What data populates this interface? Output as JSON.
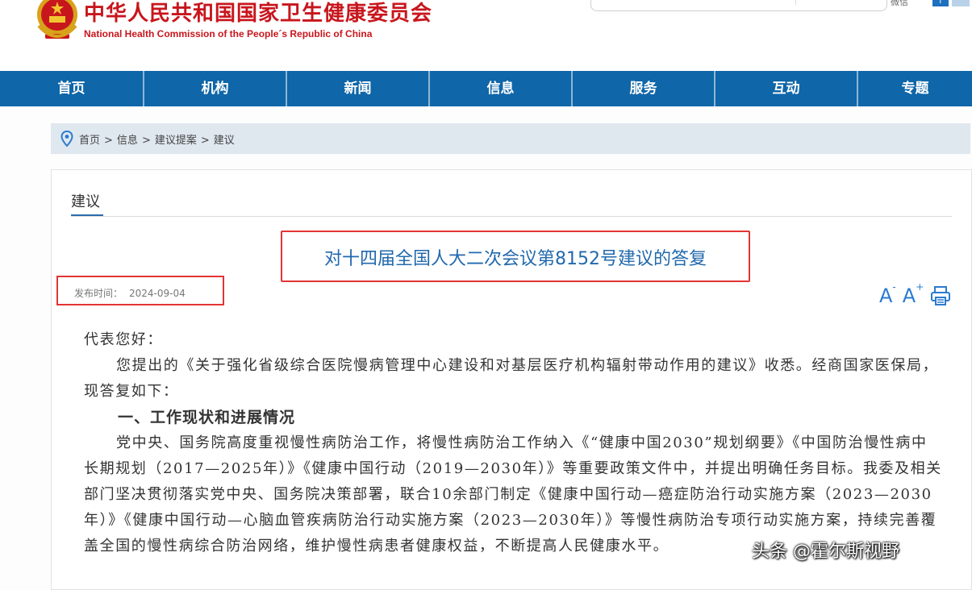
{
  "header": {
    "site_title_cn": "中华人民共和国国家卫生健康委员会",
    "site_title_en": "National Health Commission of the People´s Republic of China",
    "top_link": "微信",
    "brand_red": "#c8161d"
  },
  "nav": {
    "items": [
      {
        "label": "首页"
      },
      {
        "label": "机构"
      },
      {
        "label": "新闻"
      },
      {
        "label": "信息"
      },
      {
        "label": "服务"
      },
      {
        "label": "互动"
      },
      {
        "label": "专题"
      }
    ],
    "bg_color": "#0f66a8"
  },
  "breadcrumb": {
    "items": [
      "首页",
      "信息",
      "建议提案",
      "建议"
    ],
    "separator": ">"
  },
  "section": {
    "tab_label": "建议"
  },
  "document": {
    "title": "对十四届全国人大二次会议第8152号建议的答复",
    "date_label": "发布时间：",
    "date_value": "2024-09-04",
    "font_larger": "A",
    "font_smaller": "A",
    "paragraphs": {
      "salutation": "代表您好：",
      "p1": "您提出的《关于强化省级综合医院慢病管理中心建设和对基层医疗机构辐射带动作用的建议》收悉。经商国家医保局，现答复如下：",
      "heading1": "一、工作现状和进展情况",
      "p2": "党中央、国务院高度重视慢性病防治工作，将慢性病防治工作纳入《“健康中国2030”规划纲要》《中国防治慢性病中长期规划（2017—2025年）》《健康中国行动（2019—2030年）》等重要政策文件中，并提出明确任务目标。我委及相关部门坚决贯彻落实党中央、国务院决策部署，联合10余部门制定《健康中国行动—癌症防治行动实施方案（2023—2030年）》《健康中国行动—心脑血管疾病防治行动实施方案（2023—2030年）》等慢性病防治专项行动实施方案，持续完善覆盖全国的慢性病综合防治网络，维护慢性病患者健康权益，不断提高人民健康水平。"
    }
  },
  "watermark": "头条 @霍尔斯视野",
  "colors": {
    "title_blue": "#2169ad",
    "highlight_red": "#e23434",
    "icon_blue": "#2b7bd0"
  }
}
